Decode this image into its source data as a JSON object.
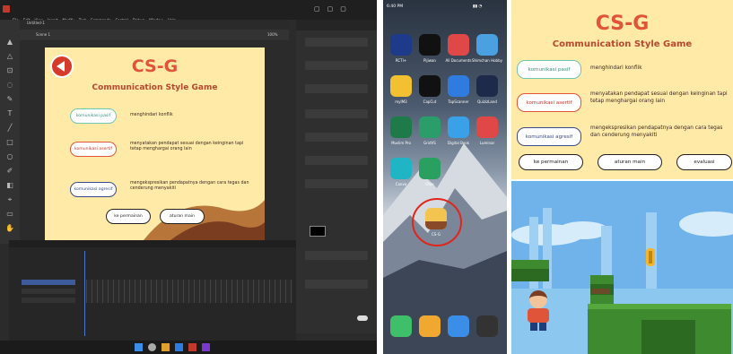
{
  "editor": {
    "menu": [
      "File",
      "Edit",
      "View",
      "Insert",
      "Modify",
      "Text",
      "Commands",
      "Control",
      "Debug",
      "Window",
      "Help"
    ],
    "doc_tab": "Untitled-1",
    "scene": "Scene 1",
    "zoom": "100%"
  },
  "game": {
    "title": "CS-G",
    "subtitle": "Communication Style Game",
    "styles": [
      {
        "label": "komunikasi pasif",
        "desc": "menghindari konflik",
        "border": "#6fc7b3"
      },
      {
        "label": "komunikasi asertif",
        "desc": "menyatakan pendapat sesuai dengan keinginan tapi tetap menghargai orang lain",
        "border": "#e0543a"
      },
      {
        "label": "komunikasi agresif",
        "desc": "mengekspresikan pendapatnya dengan cara tegas dan cenderung menyakiti",
        "border": "#3a4a8a"
      }
    ],
    "buttons": {
      "play": "ke permainan",
      "rules": "aturan main",
      "eval": "evaluasi"
    }
  },
  "phone": {
    "status_time": "6:40 PM",
    "apps": [
      {
        "name": "RCTI+",
        "color": "#1e3a8a"
      },
      {
        "name": "Pijiwan",
        "color": "#111111"
      },
      {
        "name": "All Documents",
        "color": "#e04848"
      },
      {
        "name": "Shimchan Hobby",
        "color": "#4aa0e0"
      },
      {
        "name": "myIM3",
        "color": "#f2c030"
      },
      {
        "name": "CapCut",
        "color": "#111111"
      },
      {
        "name": "TapScanner",
        "color": "#2f7be0"
      },
      {
        "name": "QuizizLand",
        "color": "#1e2a4a"
      },
      {
        "name": "Muslim Pro",
        "color": "#1f7a4a"
      },
      {
        "name": "GridVS",
        "color": "#2a9d6a"
      },
      {
        "name": "Digital Book",
        "color": "#3aa0e8"
      },
      {
        "name": "Luminar",
        "color": "#e04848"
      },
      {
        "name": "Canva",
        "color": "#1fb5c4"
      },
      {
        "name": "Ohie",
        "color": "#2aa060"
      }
    ],
    "highlight_app": "CS-G",
    "dock": [
      {
        "name": "Phone",
        "color": "#3fbf6a"
      },
      {
        "name": "Notes",
        "color": "#f0a830"
      },
      {
        "name": "Messages",
        "color": "#3a8ee8"
      },
      {
        "name": "Camera",
        "color": "#333333"
      }
    ]
  },
  "colors": {
    "stage_bg": "#ffeaa8",
    "title": "#e0543a",
    "hill": "#8a4a2a",
    "sky": "#6fb3ea",
    "grass": "#3e8a2e"
  }
}
